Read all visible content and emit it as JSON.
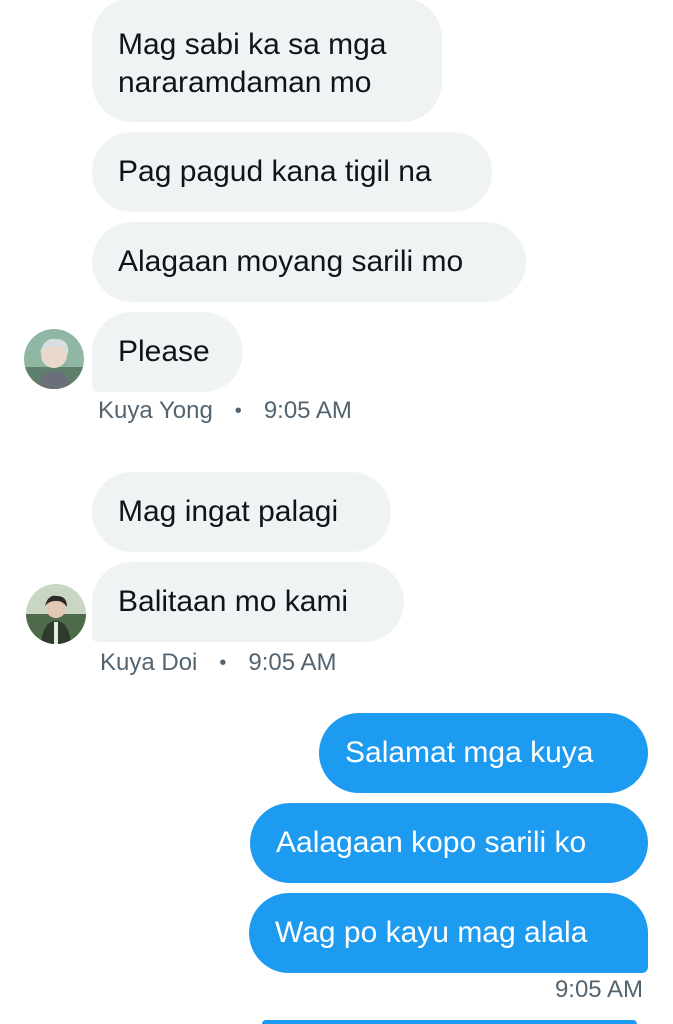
{
  "thread": {
    "group1": {
      "messages": [
        "Mag sabi ka sa mga nararamdaman mo",
        "Pag pagud kana tigil na",
        "Alagaan moyang sarili mo",
        "Please"
      ],
      "sender": "Kuya Yong",
      "separator": "•",
      "time": "9:05 AM"
    },
    "group2": {
      "messages": [
        "Mag ingat palagi",
        "Balitaan mo kami"
      ],
      "sender": "Kuya Doi",
      "separator": "•",
      "time": "9:05 AM"
    },
    "outgoing": {
      "messages": [
        "Salamat mga kuya",
        "Aalagaan kopo sarili ko",
        "Wag po kayu mag alala"
      ],
      "time": "9:05 AM"
    }
  },
  "colors": {
    "incoming_bubble": "#eff3f4",
    "outgoing_bubble": "#1d9bf0",
    "meta_text": "#536471"
  }
}
